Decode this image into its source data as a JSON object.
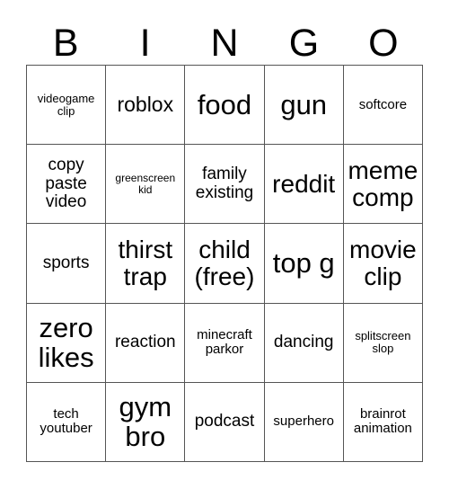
{
  "card": {
    "title": "BINGO",
    "background_color": "#ffffff",
    "text_color": "#000000",
    "border_color": "#555555",
    "columns": 5,
    "rows": 5
  },
  "header": {
    "letters": [
      "B",
      "I",
      "N",
      "G",
      "O"
    ]
  },
  "grid": {
    "cells": [
      {
        "text": "videogame clip",
        "size": "xxs"
      },
      {
        "text": "roblox",
        "size": "md"
      },
      {
        "text": "food",
        "size": "xl"
      },
      {
        "text": "gun",
        "size": "xl"
      },
      {
        "text": "softcore",
        "size": "xs"
      },
      {
        "text": "copy paste video",
        "size": "sm"
      },
      {
        "text": "greenscreen kid",
        "size": "tiny"
      },
      {
        "text": "family existing",
        "size": "sm"
      },
      {
        "text": "reddit",
        "size": "lg"
      },
      {
        "text": "meme comp",
        "size": "lg"
      },
      {
        "text": "sports",
        "size": "sm"
      },
      {
        "text": "thirst trap",
        "size": "lg"
      },
      {
        "text": "child (free)",
        "size": "lg"
      },
      {
        "text": "top g",
        "size": "xl"
      },
      {
        "text": "movie clip",
        "size": "lg"
      },
      {
        "text": "zero likes",
        "size": "xl"
      },
      {
        "text": "reaction",
        "size": "sm"
      },
      {
        "text": "minecraft parkor",
        "size": "xs"
      },
      {
        "text": "dancing",
        "size": "sm"
      },
      {
        "text": "splitscreen slop",
        "size": "xxs"
      },
      {
        "text": "tech youtuber",
        "size": "xs"
      },
      {
        "text": "gym bro",
        "size": "xl"
      },
      {
        "text": "podcast",
        "size": "sm"
      },
      {
        "text": "superhero",
        "size": "xs"
      },
      {
        "text": "brainrot animation",
        "size": "xs"
      }
    ]
  }
}
